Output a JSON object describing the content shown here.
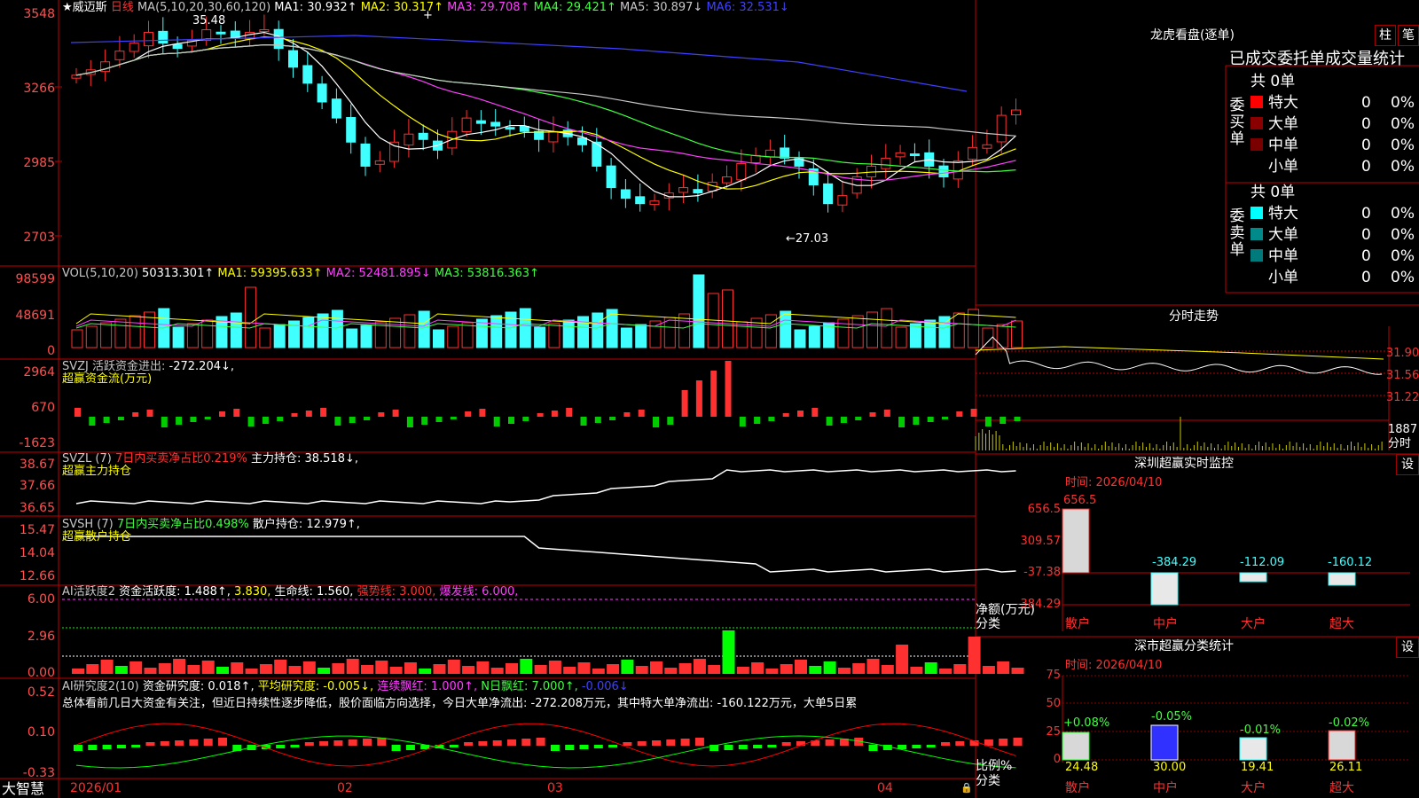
{
  "colors": {
    "bg": "#000000",
    "grid": "#a00000",
    "up": "#ff3030",
    "down": "#40ffff",
    "ma1": "#ffffff",
    "ma2": "#ffff00",
    "ma3": "#ff40ff",
    "ma4": "#40ff40",
    "ma5": "#c8c8c8",
    "ma6": "#4040ff"
  },
  "main": {
    "star": "★",
    "stock_name": "威迈斯",
    "period": "日线",
    "ma_params": "MA(5,10,20,30,60,120)",
    "ma1_label": "MA1:",
    "ma1_val": "30.932↑",
    "ma2_label": "MA2:",
    "ma2_val": "30.317↑",
    "ma3_label": "MA3:",
    "ma3_val": "29.708↑",
    "ma4_label": "MA4:",
    "ma4_val": "29.421↑",
    "ma5_label": "MA5:",
    "ma5_val": "30.897↓",
    "ma6_label": "MA6:",
    "ma6_val": "32.531↓",
    "ticks": [
      "3548",
      "3266",
      "2985",
      "2703"
    ],
    "high_marker": "35.48",
    "low_marker": "←27.03",
    "cross_mark": "+"
  },
  "vol": {
    "title": "VOL(5,10,20)",
    "val": "50313.301↑",
    "ma1": "MA1: 59395.633↑",
    "ma2": "MA2: 52481.895↓",
    "ma3": "MA3: 53816.363↑",
    "ticks": [
      "98599",
      "48691",
      "0"
    ]
  },
  "svzj": {
    "title": "SVZJ  活跃资金进出:",
    "val": "-272.204↓,",
    "sub": "超赢资金流(万元)",
    "ticks": [
      "2964",
      "670",
      "-1623"
    ]
  },
  "svzl": {
    "title": "SVZL  (7)",
    "pct": "7日内买卖净占比0.219%",
    "hold": "主力持仓: 38.518↓,",
    "sub": "超赢主力持仓",
    "ticks": [
      "38.67",
      "37.66",
      "36.65"
    ]
  },
  "svsh": {
    "title": "SVSH  (7)",
    "pct": "7日内买卖净占比0.498%",
    "hold": "散户持仓: 12.979↑,",
    "sub": "超赢散户持仓",
    "ticks": [
      "15.47",
      "14.04",
      "12.66"
    ]
  },
  "ai2": {
    "title": "AI活跃度2",
    "a": "资金活跃度: 1.488↑,",
    "b": "3.830,",
    "c": "生命线: 1.560,",
    "d": "强势线: 3.000,",
    "e": "爆发线: 6.000,",
    "ticks": [
      "6.00",
      "2.96",
      "0.00"
    ]
  },
  "ai3": {
    "title": "AI研究度2(10)",
    "a": "资金研究度: 0.018↑,",
    "b": "平均研究度: -0.005↓,",
    "c": "连续飘红: 1.000↑,",
    "d": "N日飘红: 7.000↑,",
    "e": "-0.006↓",
    "comment": "总体看前几日大资金有关注，但近日持续性逐步降低，股价面临方向选择，今日大单净流出: -272.208万元，其中特大单净流出: -160.122万元，大单5日累",
    "ticks": [
      "0.52",
      "0.10",
      "-0.33"
    ]
  },
  "xaxis": {
    "logo": "大智慧",
    "labels": [
      "2026/01",
      "02",
      "03",
      "04"
    ]
  },
  "right": {
    "title": "龙虎看盘(逐单)",
    "btn_zhu": "柱",
    "btn_bi": "笔",
    "subtitle": "已成交委托单成交量统计",
    "buy": {
      "header": "委买单",
      "count": "共 0单",
      "rows": [
        {
          "name": "特大",
          "n": "0",
          "p": "0%"
        },
        {
          "name": "大单",
          "n": "0",
          "p": "0%"
        },
        {
          "name": "中单",
          "n": "0",
          "p": "0%"
        },
        {
          "name": "小单",
          "n": "0",
          "p": "0%"
        }
      ]
    },
    "sell": {
      "header": "委卖单",
      "count": "共 0单",
      "rows": [
        {
          "name": "特大",
          "n": "0",
          "p": "0%"
        },
        {
          "name": "大单",
          "n": "0",
          "p": "0%"
        },
        {
          "name": "中单",
          "n": "0",
          "p": "0%"
        },
        {
          "name": "小单",
          "n": "0",
          "p": "0%"
        }
      ]
    },
    "intraday": {
      "title": "分时走势",
      "ticks": [
        "31.90",
        "31.56",
        "31.22"
      ],
      "vol_tick": "1887",
      "vol_label": "分时"
    },
    "monitor": {
      "title": "深圳超赢实时监控",
      "btn": "设",
      "time": "时间: 2026/04/10",
      "ticks": [
        "656.5",
        "309.57",
        "-37.38",
        "-384.29"
      ],
      "ylabel1": "净额(万元)",
      "ylabel2": "分类",
      "cats": [
        "散户",
        "中户",
        "大户",
        "超大"
      ],
      "values": [
        "656.5",
        "-384.29",
        "-112.09",
        "-160.12"
      ]
    },
    "classify": {
      "title": "深市超赢分类统计",
      "btn": "设",
      "time": "时间: 2026/04/10",
      "ticks": [
        "75",
        "50",
        "25",
        "0"
      ],
      "ylabel1": "比例%",
      "ylabel2": "分类",
      "cats": [
        "散户",
        "中户",
        "大户",
        "超大"
      ],
      "pcts": [
        "+0.08%",
        "-0.05%",
        "-0.01%",
        "-0.02%"
      ],
      "values": [
        "24.48",
        "30.00",
        "19.41",
        "26.11"
      ]
    }
  }
}
